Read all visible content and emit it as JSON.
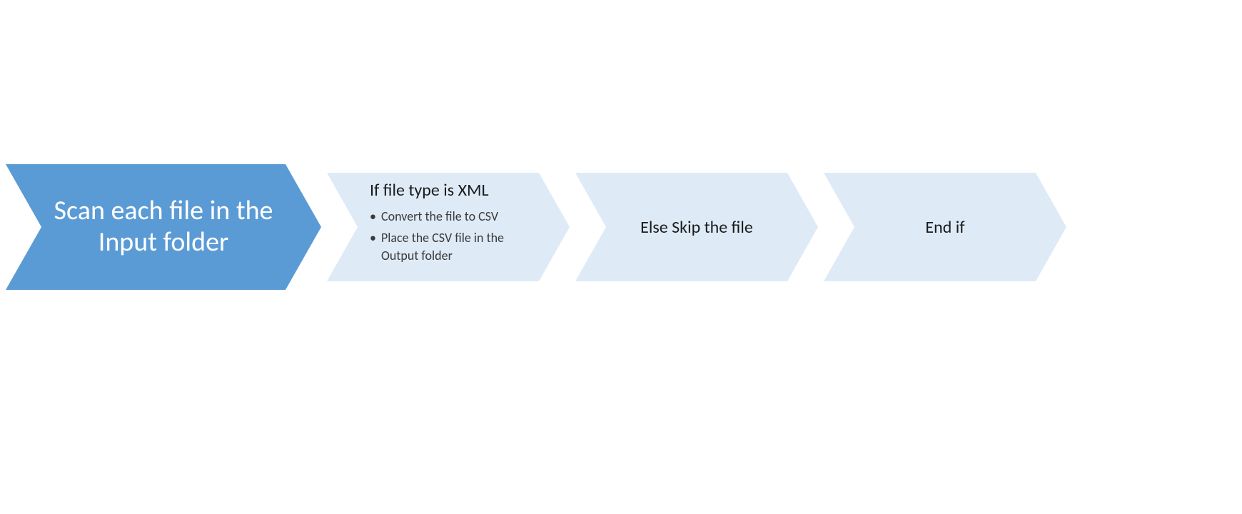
{
  "diagram": {
    "steps": [
      {
        "id": "scan",
        "title": "Scan each file in the Input folder",
        "bullets": []
      },
      {
        "id": "if-xml",
        "title": "If file type is XML",
        "bullets": [
          "Convert the file to CSV",
          "Place the CSV file in the Output folder"
        ]
      },
      {
        "id": "else-skip",
        "title": "Else Skip the file",
        "bullets": []
      },
      {
        "id": "end-if",
        "title": "End if",
        "bullets": []
      }
    ],
    "colors": {
      "primary_fill": "#5b9bd5",
      "secondary_fill": "#deebf7",
      "primary_text": "#ffffff",
      "secondary_text": "#1b1b1b"
    }
  }
}
